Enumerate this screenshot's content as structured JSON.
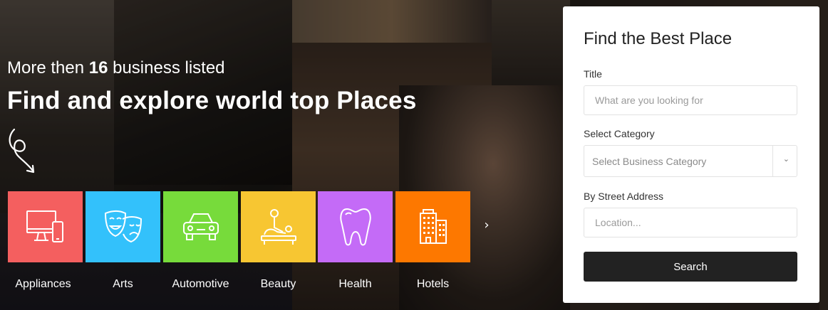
{
  "hero": {
    "subtitle_prefix": "More then",
    "subtitle_count": "16",
    "subtitle_suffix": "business listed",
    "title": "Find and explore world top Places"
  },
  "categories": [
    {
      "label": "Appliances",
      "icon": "monitor-icon",
      "color": "#f45f5f"
    },
    {
      "label": "Arts",
      "icon": "theater-masks-icon",
      "color": "#33c1fb"
    },
    {
      "label": "Automotive",
      "icon": "car-icon",
      "color": "#77db3b"
    },
    {
      "label": "Beauty",
      "icon": "massage-icon",
      "color": "#f7c632"
    },
    {
      "label": "Health",
      "icon": "tooth-icon",
      "color": "#c46bf7"
    },
    {
      "label": "Hotels",
      "icon": "building-icon",
      "color": "#fd7800"
    }
  ],
  "carousel_next": "›",
  "search": {
    "title": "Find the Best Place",
    "title_label": "Title",
    "title_placeholder": "What are you looking for",
    "category_label": "Select Category",
    "category_value": "Select Business Category",
    "address_label": "By Street Address",
    "address_placeholder": "Location...",
    "button_label": "Search"
  }
}
